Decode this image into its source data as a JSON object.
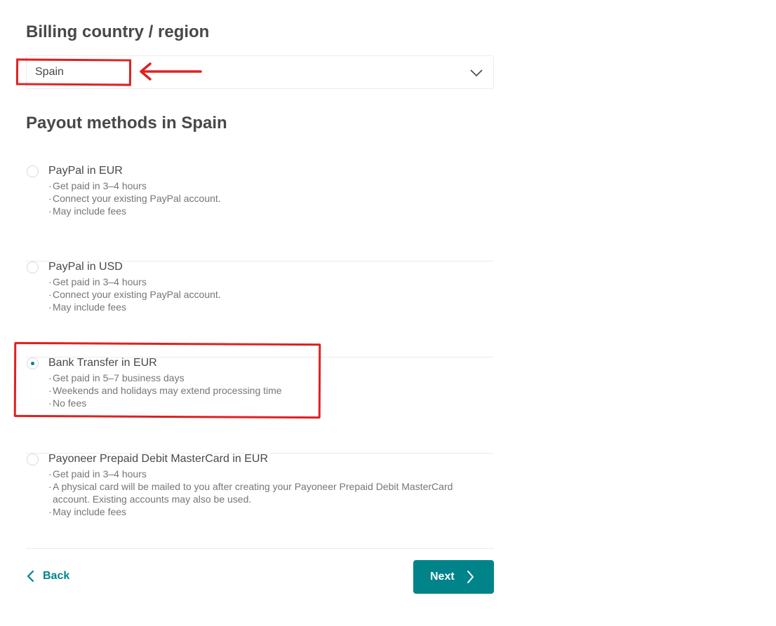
{
  "billing": {
    "title": "Billing country / region",
    "selected_country": "Spain"
  },
  "payout": {
    "title": "Payout methods in Spain",
    "selected_index": 2,
    "methods": [
      {
        "title": "PayPal in EUR",
        "details": [
          "Get paid in 3–4 hours",
          "Connect your existing PayPal account.",
          "May include fees"
        ]
      },
      {
        "title": "PayPal in USD",
        "details": [
          "Get paid in 3–4 hours",
          "Connect your existing PayPal account.",
          "May include fees"
        ]
      },
      {
        "title": "Bank Transfer in EUR",
        "details": [
          "Get paid in 5–7 business days",
          "Weekends and holidays may extend processing time",
          "No fees"
        ]
      },
      {
        "title": "Payoneer Prepaid Debit MasterCard in EUR",
        "details": [
          "Get paid in 3–4 hours",
          "A physical card will be mailed to you after creating your Payoneer Prepaid Debit MasterCard account. Existing accounts may also be used.",
          "May include fees"
        ]
      }
    ]
  },
  "footer": {
    "back_label": "Back",
    "next_label": "Next"
  },
  "icons": {
    "select_chevron": "chevron-down-icon",
    "back": "chevron-left-icon",
    "next": "chevron-right-icon"
  },
  "colors": {
    "accent": "#00848a",
    "text": "#484848",
    "muted": "#767676",
    "annotation": "#e02020"
  }
}
